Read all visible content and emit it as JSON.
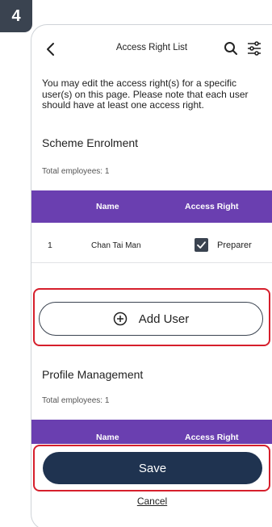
{
  "step_badge": "4",
  "header": {
    "title": "Access Right List",
    "back_icon": "chevron-left-icon",
    "search_icon": "search-icon",
    "filter_icon": "sliders-icon"
  },
  "intro_text": "You may edit the access right(s) for a specific user(s) on this page. Please note that each user should have at least one access right.",
  "sections": [
    {
      "title": "Scheme Enrolment",
      "total": "Total employees: 1",
      "columns": [
        "Name",
        "Access Right"
      ],
      "rows": [
        {
          "index": "1",
          "name": "Chan Tai Man",
          "checked": true,
          "role": "Preparer"
        }
      ]
    },
    {
      "title": "Profile Management",
      "total": "Total employees: 1",
      "columns": [
        "Name",
        "Access Right"
      ]
    }
  ],
  "add_user_label": "Add User",
  "save_label": "Save",
  "cancel_label": "Cancel",
  "colors": {
    "table_header": "#6a3fb0",
    "primary_button": "#1f3350",
    "highlight": "#d61f2c"
  }
}
